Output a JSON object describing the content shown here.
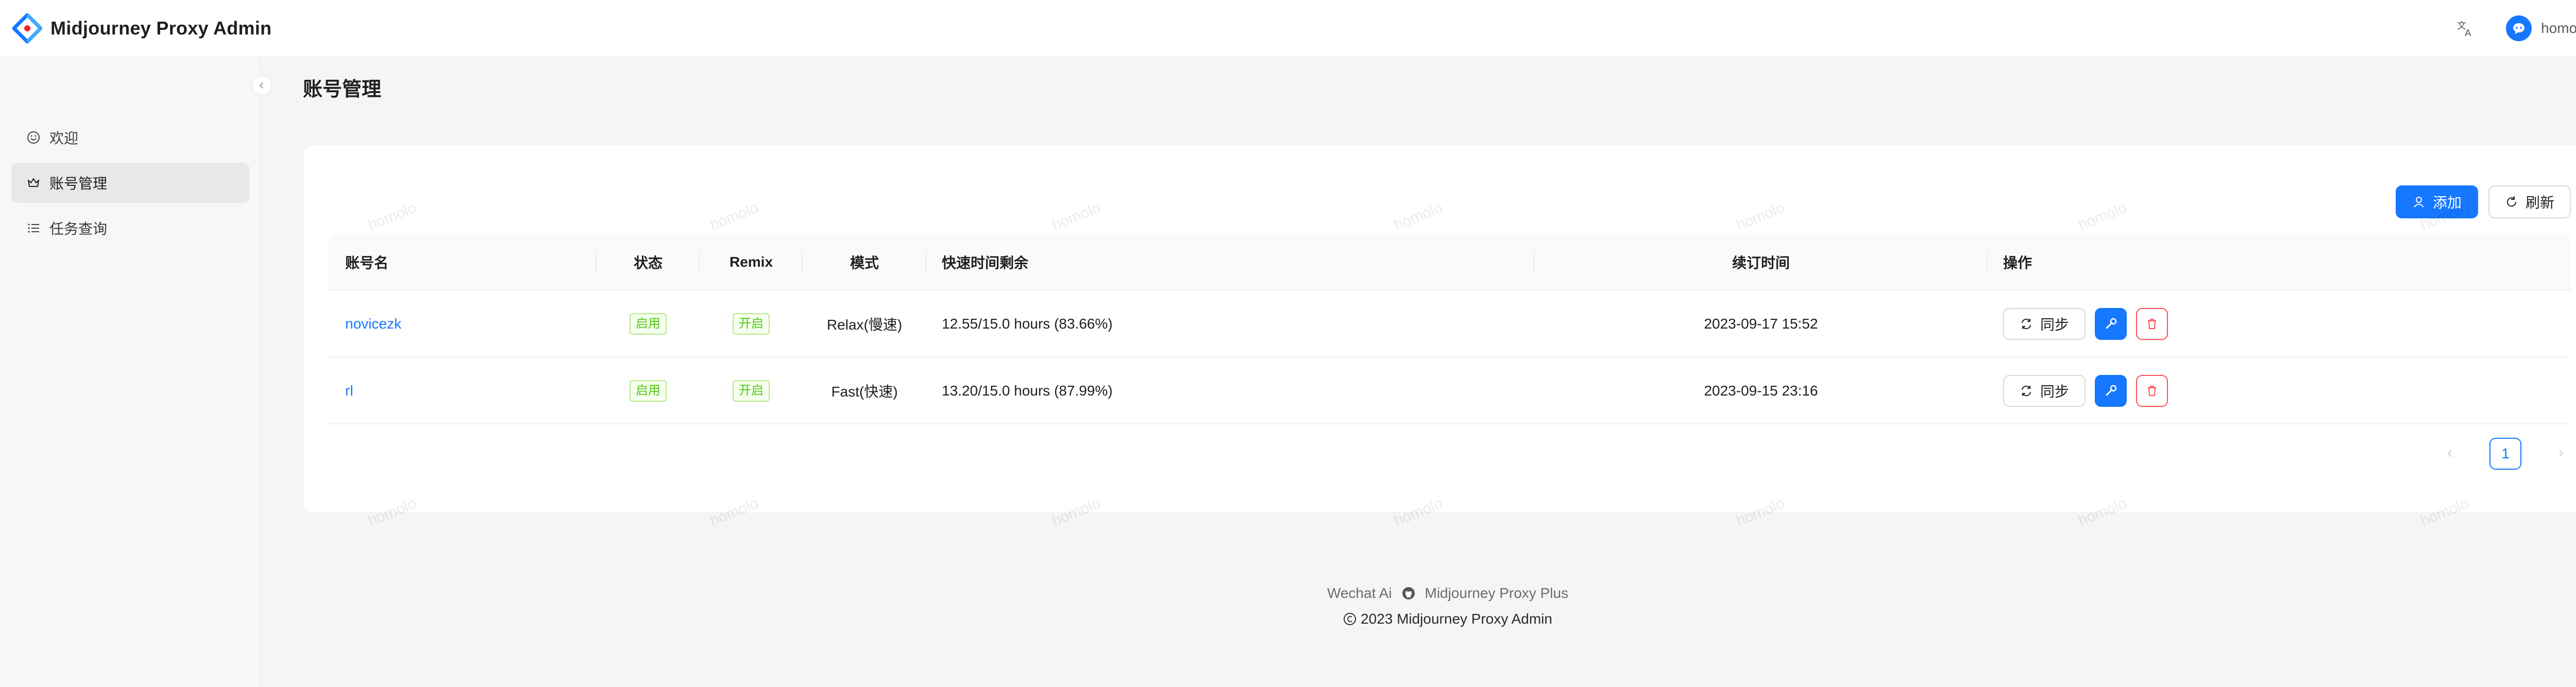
{
  "app": {
    "title": "Midjourney Proxy Admin"
  },
  "header": {
    "language_icon": "translate-icon",
    "username": "homolo"
  },
  "sidebar": {
    "items": [
      {
        "label": "欢迎",
        "icon": "smile-icon",
        "active": false
      },
      {
        "label": "账号管理",
        "icon": "crown-icon",
        "active": true
      },
      {
        "label": "任务查询",
        "icon": "list-icon",
        "active": false
      }
    ]
  },
  "page": {
    "title": "账号管理"
  },
  "toolbar": {
    "add_label": "添加",
    "refresh_label": "刷新"
  },
  "table": {
    "columns": [
      "账号名",
      "状态",
      "Remix",
      "模式",
      "快速时间剩余",
      "续订时间",
      "操作"
    ],
    "rows": [
      {
        "name": "novicezk",
        "status": "启用",
        "remix": "开启",
        "mode": "Relax(慢速)",
        "fast_remaining": "12.55/15.0 hours (83.66%)",
        "renew_time": "2023-09-17 15:52",
        "sync_label": "同步"
      },
      {
        "name": "rl",
        "status": "启用",
        "remix": "开启",
        "mode": "Fast(快速)",
        "fast_remaining": "13.20/15.0 hours (87.99%)",
        "renew_time": "2023-09-15 23:16",
        "sync_label": "同步"
      }
    ]
  },
  "pagination": {
    "current": "1"
  },
  "footer": {
    "link1": "Wechat Ai",
    "link2": "Midjourney Proxy Plus",
    "copyright": "2023 Midjourney Proxy Admin"
  },
  "watermark": {
    "text": "homolo"
  },
  "colors": {
    "primary": "#1677ff",
    "success": "#52c41a",
    "danger": "#ff4d4f"
  }
}
